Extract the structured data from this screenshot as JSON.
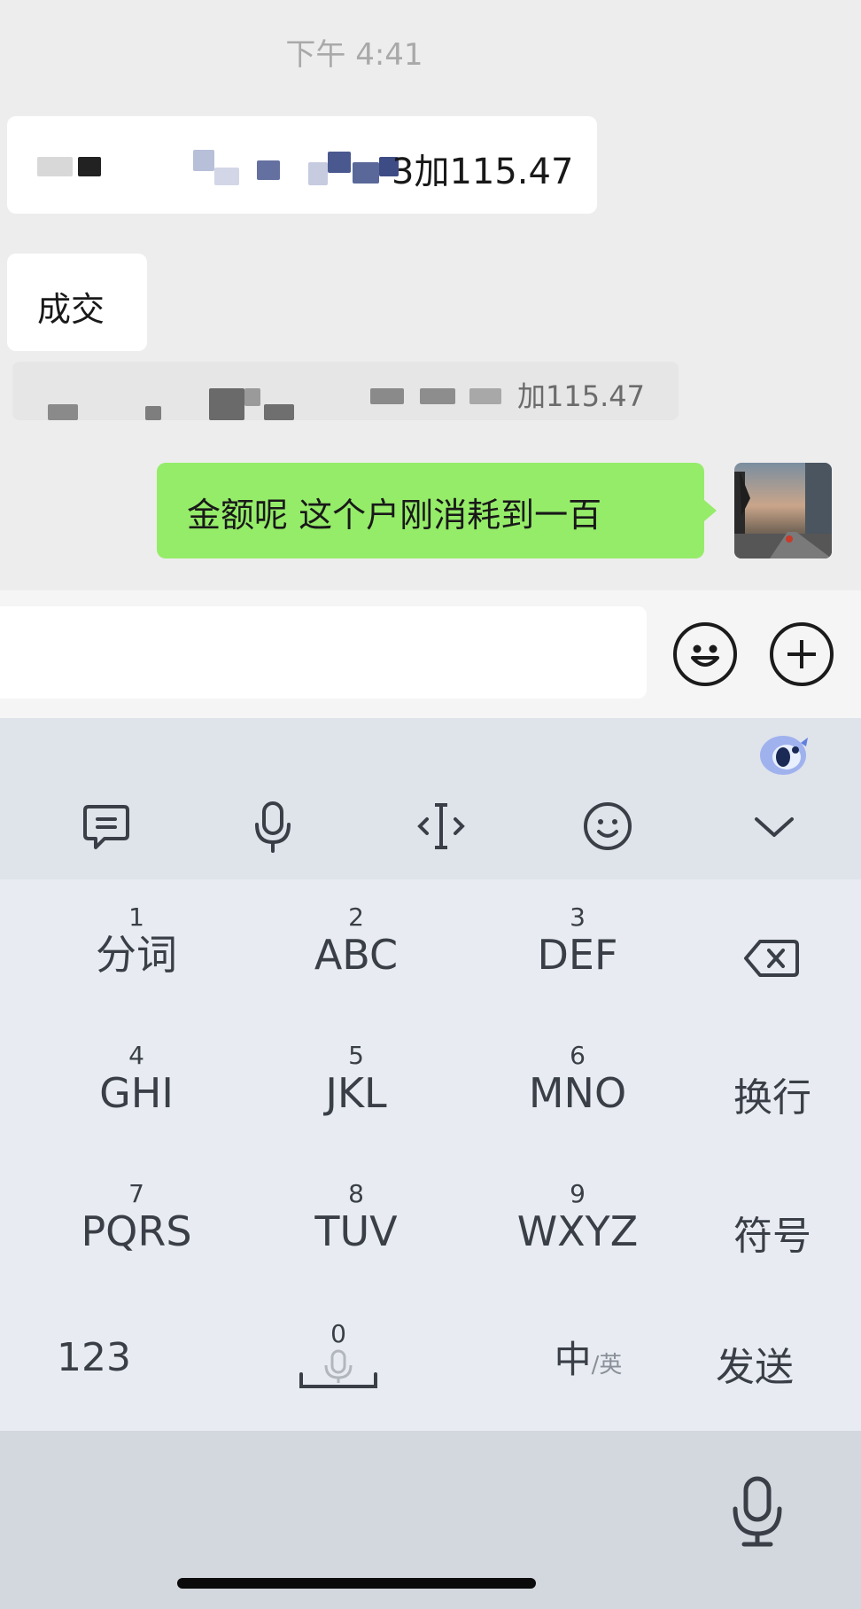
{
  "chat": {
    "timestamp": "下午 4:41",
    "messages": [
      {
        "side": "left",
        "type": "text",
        "text_visible": "3加115.47"
      },
      {
        "side": "left",
        "type": "text",
        "text": "成交"
      },
      {
        "side": "left",
        "type": "system-like",
        "text_visible": "加115.47"
      },
      {
        "side": "right",
        "type": "text",
        "text": "金额呢 这个户刚消耗到一百"
      }
    ]
  },
  "composer": {
    "input_value": "",
    "emoji_icon": "smiley-icon",
    "plus_icon": "plus-circle-icon"
  },
  "keyboard": {
    "toolbar": [
      "clipboard-icon",
      "microphone-icon",
      "cursor-icon",
      "emoji-icon",
      "chevron-down-icon"
    ],
    "mascot_icon": "ime-mascot-icon",
    "rows": [
      [
        {
          "num": "1",
          "label": "分词"
        },
        {
          "num": "2",
          "label": "ABC"
        },
        {
          "num": "3",
          "label": "DEF"
        }
      ],
      [
        {
          "num": "4",
          "label": "GHI"
        },
        {
          "num": "5",
          "label": "JKL"
        },
        {
          "num": "6",
          "label": "MNO"
        }
      ],
      [
        {
          "num": "7",
          "label": "PQRS"
        },
        {
          "num": "8",
          "label": "TUV"
        },
        {
          "num": "9",
          "label": "WXYZ"
        }
      ]
    ],
    "side_keys": {
      "backspace": "backspace-icon",
      "newline": "换行",
      "symbols": "符号",
      "send": "发送"
    },
    "bottom": {
      "numeric": "123",
      "zero_num": "0",
      "lang_main": "中",
      "lang_sep": "/",
      "lang_alt": "英"
    },
    "dictation_icon": "microphone-icon"
  },
  "colors": {
    "outgoing_bubble": "#95ec69",
    "incoming_bubble": "#ffffff",
    "chat_bg": "#ededed"
  }
}
